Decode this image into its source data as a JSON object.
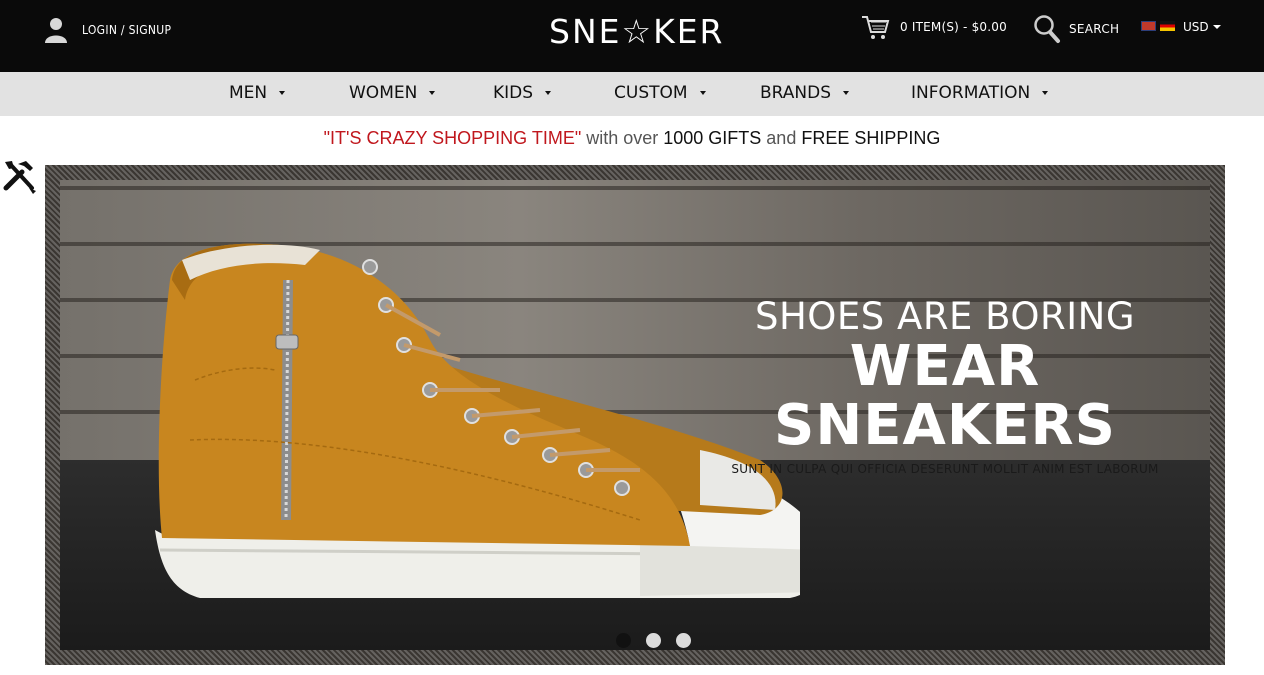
{
  "header": {
    "login_label": "LOGIN  / SIGNUP",
    "logo_text": "SNE☆KER",
    "cart_label": "0 ITEM(S) - $0.00",
    "search_label": "SEARCH",
    "currency_label": "USD"
  },
  "nav": {
    "items": [
      {
        "label": "MEN"
      },
      {
        "label": "WOMEN"
      },
      {
        "label": "KIDS"
      },
      {
        "label": "CUSTOM"
      },
      {
        "label": "BRANDS"
      },
      {
        "label": "INFORMATION"
      }
    ]
  },
  "promo": {
    "highlight": "\"IT'S CRAZY SHOPPING TIME\"",
    "text1": " with over ",
    "gifts": "1000 GIFTS",
    "text2": " and ",
    "shipping": "FREE SHIPPING"
  },
  "banner": {
    "line1": "SHOES ARE BORING",
    "line2": "WEAR SNEAKERS",
    "line3": "SUNT IN CULPA QUI OFFICIA DESERUNT MOLLIT ANIM EST LABORUM",
    "slides": 3,
    "active_slide": 1
  },
  "colors": {
    "topbar": "#0a0a0a",
    "nav": "#e2e2e2",
    "promo_red": "#c0171d",
    "shoe": "#c8861f"
  }
}
